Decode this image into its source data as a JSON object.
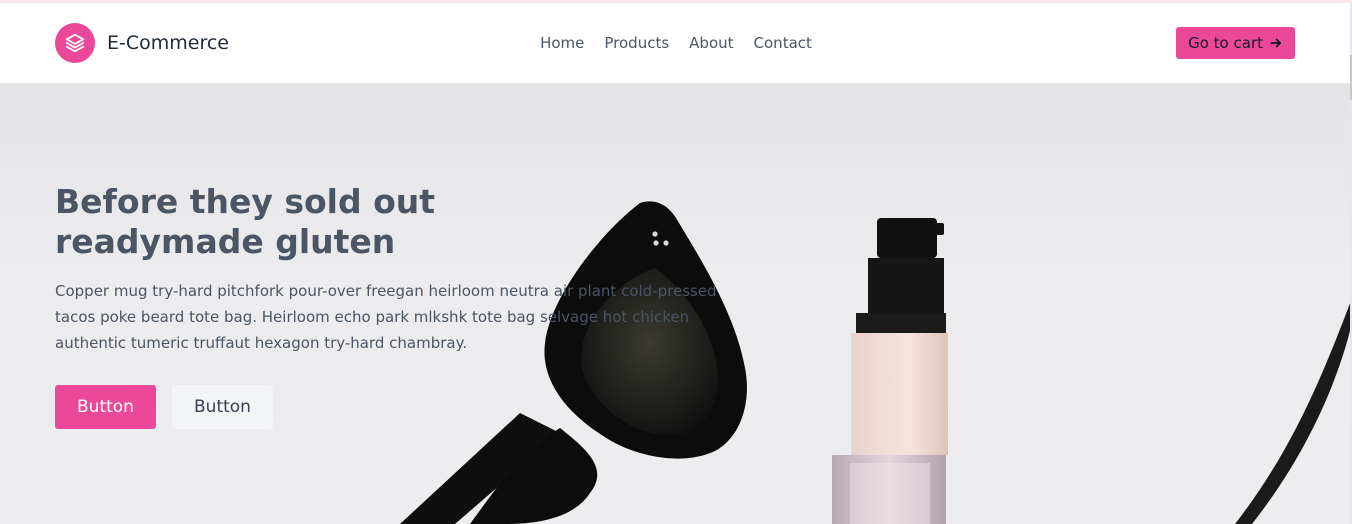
{
  "header": {
    "brand_name": "E-Commerce",
    "logo_icon": "layers-icon",
    "nav": [
      {
        "label": "Home"
      },
      {
        "label": "Products"
      },
      {
        "label": "About"
      },
      {
        "label": "Contact"
      }
    ],
    "cart_button": {
      "label": "Go to cart",
      "icon": "arrow-right-icon"
    }
  },
  "hero": {
    "title_lines": [
      "Before they sold out",
      "readymade gluten"
    ],
    "description_lines": [
      "Copper mug try-hard pitchfork pour-over freegan heirloom neutra air plant cold-pressed",
      "tacos poke beard tote bag. Heirloom echo park mlkshk tote bag selvage hot chicken",
      "authentic tumeric truffaut hexagon try-hard chambray."
    ],
    "primary_button": "Button",
    "secondary_button": "Button",
    "image_subject": "sunglasses-and-cosmetic-bottle-photo"
  },
  "colors": {
    "accent": "#ec4899",
    "text": "#4b5563",
    "brand_text": "#1f2937",
    "secondary_button_bg": "#f3f4f6"
  }
}
